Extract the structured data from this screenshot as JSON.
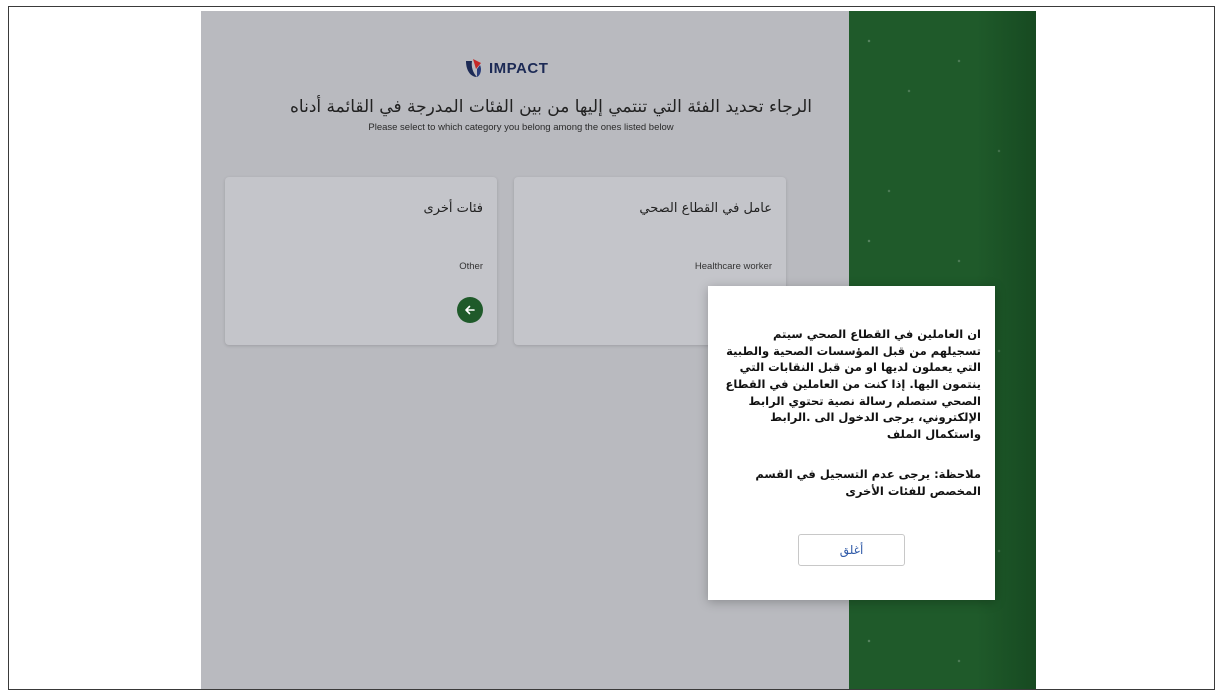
{
  "app": {
    "logo_text": "IMPACT"
  },
  "header": {
    "title_ar": "الرجاء تحديد الفئة التي تنتمي إليها من بين الفئات المدرجة في القائمة أدناه",
    "title_en": "Please select to which category you belong among the ones listed below"
  },
  "cards": [
    {
      "title_ar": "فئات أخرى",
      "label_en": "Other",
      "icon": "arrow-left-icon"
    },
    {
      "title_ar": "عامل في القطاع الصحي",
      "label_en": "Healthcare worker"
    }
  ],
  "modal": {
    "body_ar": "ان العاملين في القطاع الصحي سيتم تسجيلهم من قبل المؤسسات الصحية والطبية التي يعملون لديها او من قبل النقابات التي ينتمون اليها. إذا كنت من العاملين في القطاع الصحي ستصلم رسالة نصية تحتوي الرابط الإلكتروني، يرجى الدخول الى .الرابط واستكمال الملف",
    "note_ar": "ملاحظة: يرجى عدم التسجيل في القسم المخصص للفئات الأخرى",
    "close_label": "أغلق"
  },
  "colors": {
    "brand_green": "#1f5a2a",
    "link_blue": "#2f5aa8",
    "logo_navy": "#1c2a55"
  }
}
